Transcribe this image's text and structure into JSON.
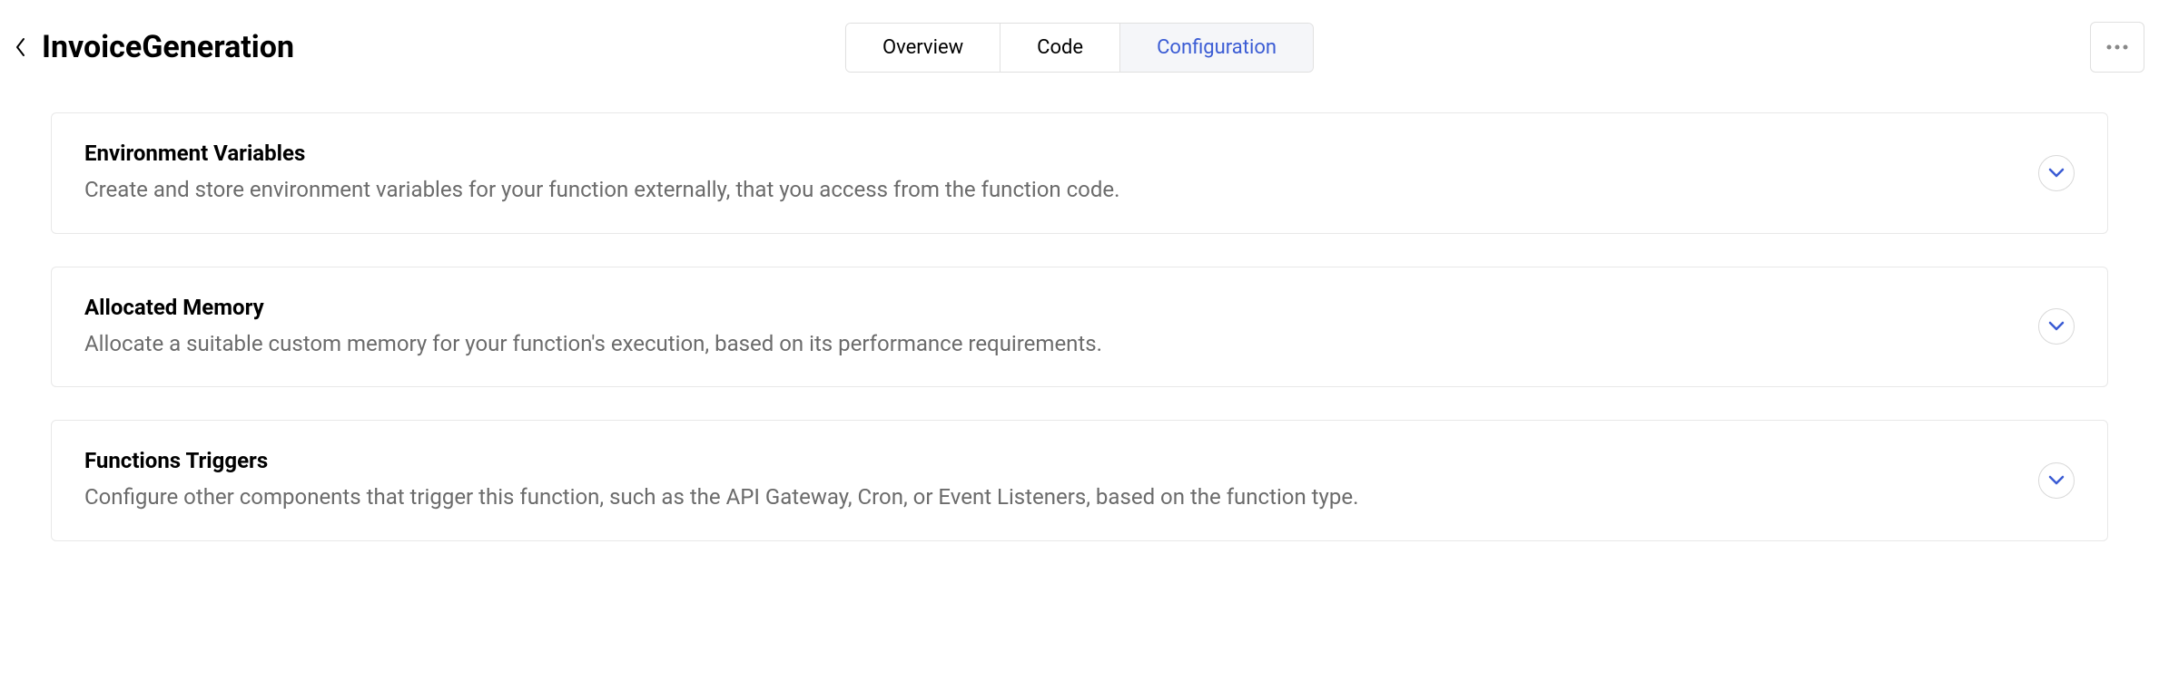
{
  "header": {
    "title": "InvoiceGeneration"
  },
  "tabs": [
    {
      "label": "Overview",
      "active": false
    },
    {
      "label": "Code",
      "active": false
    },
    {
      "label": "Configuration",
      "active": true
    }
  ],
  "cards": [
    {
      "title": "Environment Variables",
      "description": "Create and store environment variables for your function externally, that you access from the function code."
    },
    {
      "title": "Allocated Memory",
      "description": "Allocate a suitable custom memory for your function's execution, based on its performance requirements."
    },
    {
      "title": "Functions Triggers",
      "description": "Configure other components that trigger this function, such as the API Gateway, Cron, or Event Listeners, based on the function type."
    }
  ]
}
